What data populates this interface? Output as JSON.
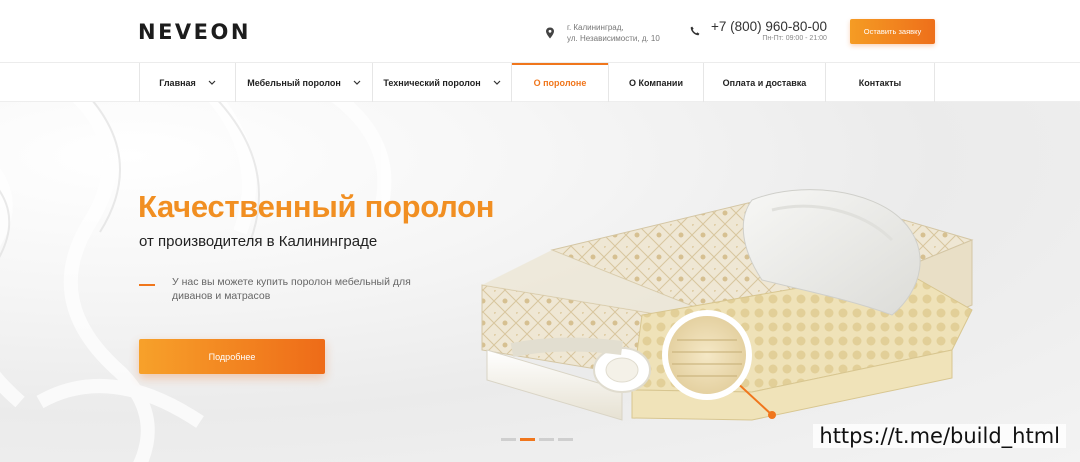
{
  "header": {
    "logo": "NEVEON",
    "address_line1": "г. Калининград,",
    "address_line2": "ул. Независимости, д. 10",
    "phone": "+7 (800) 960-80-00",
    "hours": "Пн-Пт: 09:00 - 21:00",
    "cta": "Оставить заявку"
  },
  "nav": {
    "items": [
      {
        "label": "Главная"
      },
      {
        "label": "Мебельный поролон"
      },
      {
        "label": "Технический поролон"
      },
      {
        "label": "О поролоне"
      },
      {
        "label": "О Компании"
      },
      {
        "label": "Оплата и доставка"
      },
      {
        "label": "Контакты"
      }
    ],
    "active_index": 3
  },
  "hero": {
    "title": "Качественный поролон",
    "subtitle": "от производителя в Калининграде",
    "description": "У нас вы можете купить поролон мебельный для диванов и матрасов",
    "cta": "Подробнее",
    "slide_count": 4,
    "active_slide": 1
  },
  "watermark": "https://t.me/build_html",
  "colors": {
    "accent": "#f0761c",
    "accent_light": "#f59c24",
    "title_orange": "#f18f22",
    "text_dark": "#222222"
  },
  "icons": {
    "address": "map-pin-icon",
    "phone": "phone-icon",
    "dropdown": "chevron-down-icon"
  }
}
